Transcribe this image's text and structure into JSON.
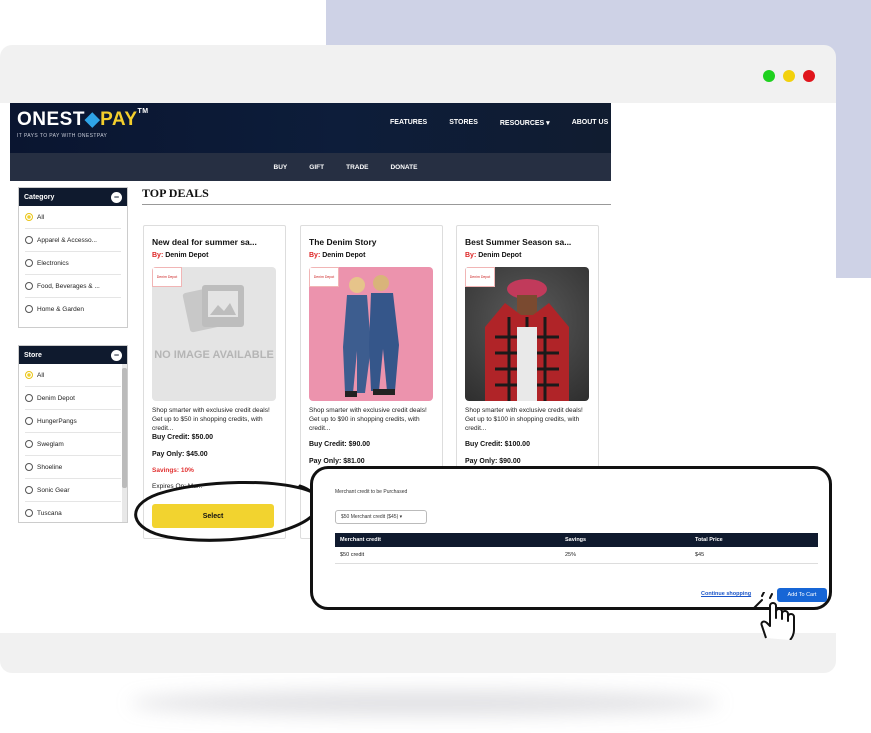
{
  "app": {
    "logo_main": "ONEST",
    "logo_pay": "PAY",
    "logo_tm": "TM",
    "tagline": "IT PAYS TO PAY WITH ONESTPAY",
    "top_nav": [
      "FEATURES",
      "STORES",
      "RESOURCES ▾",
      "ABOUT US"
    ],
    "sub_nav": [
      "BUY",
      "GIFT",
      "TRADE",
      "DONATE"
    ]
  },
  "category": {
    "title": "Category",
    "options": [
      "All",
      "Apparel & Accesso...",
      "Electronics",
      "Food, Beverages & ...",
      "Home & Garden"
    ]
  },
  "store": {
    "title": "Store",
    "options": [
      "All",
      "Denim Depot",
      "HungerPangs",
      "Sweglam",
      "Shoeline",
      "Sonic Gear",
      "Tuscana"
    ]
  },
  "page_title": "TOP DEALS",
  "cards": [
    {
      "name": "New deal for summer sa...",
      "by_label": "By:",
      "store": "Denim Depot",
      "badge": "Denim Depot",
      "image_text": "NO IMAGE AVAILABLE",
      "description": "Shop smarter with exclusive credit deals! Get up to $50 in shopping credits, with credit...",
      "buy_credit": "Buy Credit: $50.00",
      "pay_only": "Pay Only: $45.00",
      "savings": "Savings: 10%",
      "expires": "Expires On: Ma...",
      "select_label": "Select"
    },
    {
      "name": "The Denim Story",
      "by_label": "By:",
      "store": "Denim Depot",
      "badge": "Denim Depot",
      "description": "Shop smarter with exclusive credit deals! Get up to $90 in shopping credits, with credit...",
      "buy_credit": "Buy Credit: $90.00",
      "pay_only": "Pay Only: $81.00"
    },
    {
      "name": "Best Summer Season sa...",
      "by_label": "By:",
      "store": "Denim Depot",
      "badge": "Denim Depot",
      "description": "Shop smarter with exclusive credit deals! Get up to $100 in shopping credits, with credit...",
      "buy_credit": "Buy Credit: $100.00",
      "pay_only": "Pay Only: $90.00"
    }
  ],
  "popup": {
    "title": "Merchant credit to be Purchased",
    "select_value": "$50 Merchant credit ($45) ▾",
    "columns": [
      "Merchant credit",
      "Savings",
      "Total Price"
    ],
    "rows": [
      [
        "$50 credit",
        "25%",
        "$45"
      ]
    ],
    "continue_link": "Continue shopping",
    "add_button": "Add To Cart"
  },
  "colors": {
    "nav_dark": "#0d1d3a",
    "accent_yellow": "#f2d32f",
    "savings_red": "#e23131",
    "button_blue": "#1766d6",
    "bg_lavender": "#ced2e6"
  }
}
